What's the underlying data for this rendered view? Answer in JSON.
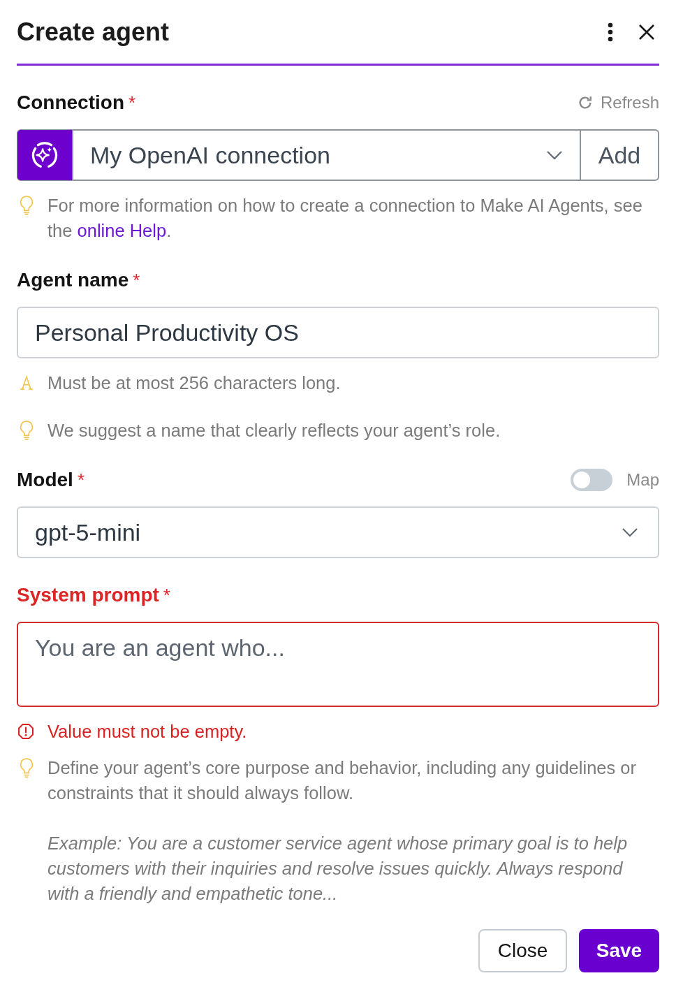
{
  "header": {
    "title": "Create agent"
  },
  "fields": [
    {
      "kind": "connection",
      "label": "Connection",
      "required_mark": "*",
      "action": "Refresh",
      "value": "My OpenAI connection",
      "button": "Add",
      "invalid": false,
      "notes": [
        {
          "kind": "hint",
          "text": "For more information on how to create a connection to Make AI Agents, see the ",
          "link": "online Help",
          "after": "."
        }
      ]
    },
    {
      "kind": "text",
      "label": "Agent name",
      "required_mark": "*",
      "value": "Personal Productivity OS",
      "invalid": false,
      "notes": [
        {
          "kind": "warning",
          "text": "Must be at most 256 characters long."
        },
        {
          "kind": "hint",
          "text": "We suggest a name that clearly reflects your agent’s role."
        }
      ]
    },
    {
      "kind": "select",
      "label": "Model",
      "required_mark": "*",
      "map": {
        "label": "Map",
        "on": false
      },
      "value": "gpt-5-mini",
      "invalid": false
    },
    {
      "kind": "textarea",
      "label": "System prompt",
      "required_mark": "*",
      "placeholder": "You are an agent who...",
      "invalid": true,
      "notes": [
        {
          "kind": "error",
          "text": "Value must not be empty."
        },
        {
          "kind": "hint",
          "text": "Define your agent’s core purpose and behavior, including any guidelines or constraints that it should always follow.",
          "example": "Example: You are a customer service agent whose primary goal is to help customers with their inquiries and resolve issues quickly. Always respond with a friendly and empathetic tone..."
        }
      ]
    }
  ],
  "buttons": [
    {
      "label": "Close",
      "kind": "secondary"
    },
    {
      "label": "Save",
      "kind": "primary"
    }
  ]
}
